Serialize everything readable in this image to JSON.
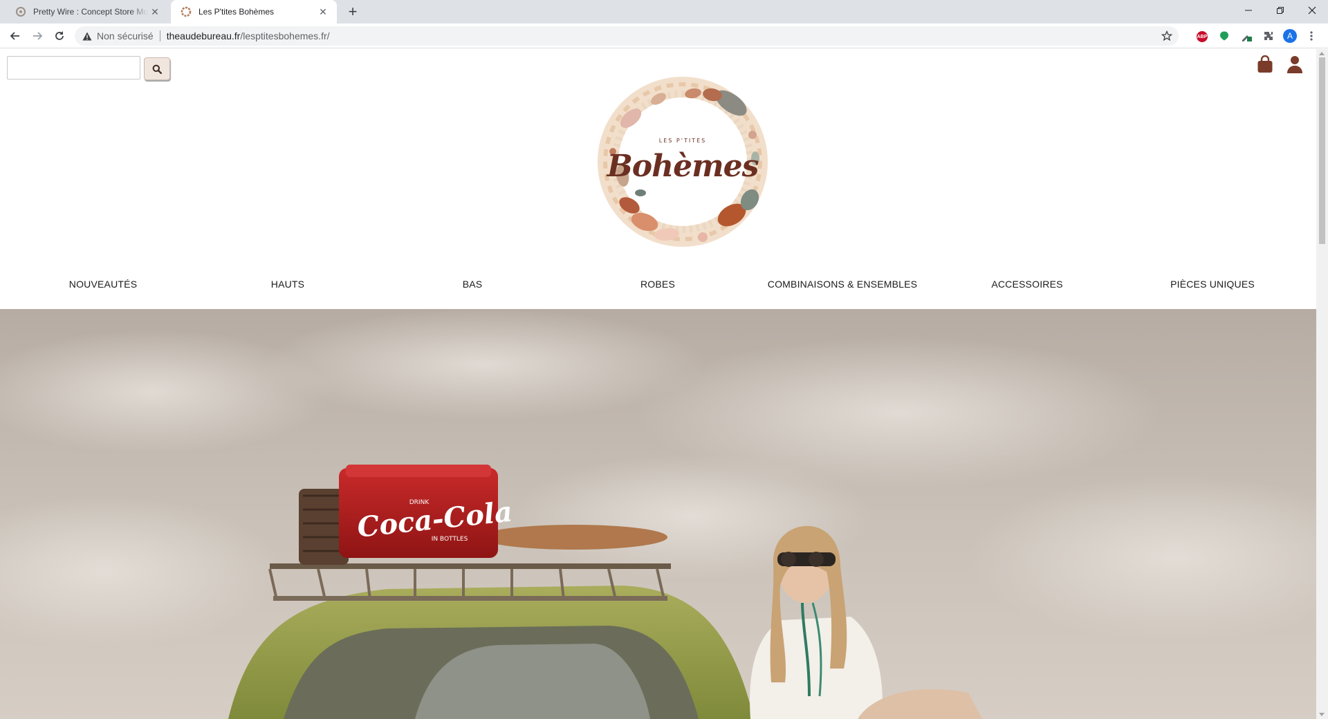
{
  "browser": {
    "tabs": [
      {
        "title": "Pretty Wire : Concept Store Mode",
        "active": false
      },
      {
        "title": "Les P'tites Bohèmes",
        "active": true
      }
    ],
    "address_bar": {
      "security_label": "Non sécurisé",
      "url_host": "theaudebureau.fr",
      "url_path": "/lesptitesbohemes.fr/"
    },
    "profile_initial": "A",
    "extension_abp": "ABP"
  },
  "site": {
    "search": {
      "placeholder": "",
      "value": ""
    },
    "logo": {
      "small_text": "LES P'TITES",
      "big_text": "Bohèmes"
    },
    "nav": [
      "NOUVEAUTÉS",
      "HAUTS",
      "BAS",
      "ROBES",
      "COMBINAISONS & ENSEMBLES",
      "ACCESSOIRES",
      "PIÈCES UNIQUES"
    ],
    "hero": {
      "cooler_text_1": "DRINK",
      "cooler_text_2": "Coca-Cola",
      "cooler_text_3": "IN BOTTLES"
    }
  },
  "colors": {
    "brand_brown": "#6b2f22",
    "icon_brown": "#7a3b2a"
  }
}
